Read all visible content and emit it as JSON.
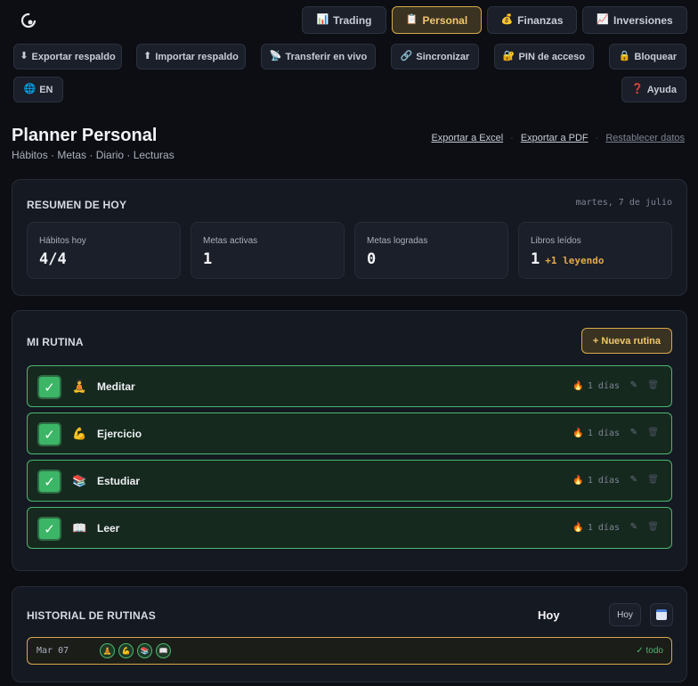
{
  "nav": [
    {
      "label": "Trading",
      "icon": "chart-icon",
      "glyph": "📊",
      "active": false
    },
    {
      "label": "Personal",
      "icon": "clipboard-icon",
      "glyph": "📋",
      "active": true
    },
    {
      "label": "Finanzas",
      "icon": "money-bag-icon",
      "glyph": "💰",
      "active": false
    },
    {
      "label": "Inversiones",
      "icon": "trend-icon",
      "glyph": "📈",
      "active": false
    }
  ],
  "toolbar": {
    "export_backup": "Exportar respaldo",
    "import_backup": "Importar respaldo",
    "transfer_live": "Transferir en vivo",
    "sync": "Sincronizar",
    "pin": "PIN de acceso",
    "lock": "Bloquear",
    "lang": "EN",
    "help": "Ayuda",
    "glyphs": {
      "export": "⬇",
      "import": "⬆",
      "transfer": "📡",
      "sync": "🔗",
      "pin": "🔐",
      "lock": "🔒",
      "lang": "🌐",
      "help": "❓"
    }
  },
  "header": {
    "title": "Planner Personal",
    "subtitle": "Hábitos · Metas · Diario · Lecturas",
    "export_excel": "Exportar a Excel",
    "export_pdf": "Exportar a PDF",
    "reset": "Restablecer datos"
  },
  "summary": {
    "title": "RESUMEN DE HOY",
    "date": "martes, 7 de julio",
    "stats": [
      {
        "label": "Hábitos hoy",
        "value": "4/4",
        "extra": ""
      },
      {
        "label": "Metas activas",
        "value": "1",
        "extra": ""
      },
      {
        "label": "Metas logradas",
        "value": "0",
        "extra": ""
      },
      {
        "label": "Libros leídos",
        "value": "1",
        "extra": "+1 leyendo"
      }
    ]
  },
  "routine": {
    "title": "MI RUTINA",
    "new_button": "+ Nueva rutina",
    "habits": [
      {
        "name": "Meditar",
        "icon": "meditation-icon",
        "glyph": "🧘",
        "streak": "1 días",
        "done": true
      },
      {
        "name": "Ejercicio",
        "icon": "muscle-icon",
        "glyph": "💪",
        "streak": "1 días",
        "done": true
      },
      {
        "name": "Estudiar",
        "icon": "books-icon",
        "glyph": "📚",
        "streak": "1 días",
        "done": true
      },
      {
        "name": "Leer",
        "icon": "open-book-icon",
        "glyph": "📖",
        "streak": "1 días",
        "done": true
      }
    ]
  },
  "history": {
    "title": "HISTORIAL DE RUTINAS",
    "current_label": "Hoy",
    "today_button": "Hoy",
    "rows": [
      {
        "date": "Mar 07",
        "glyphs": [
          "🧘",
          "💪",
          "📚",
          "📖"
        ],
        "status": "✓ todo"
      }
    ]
  },
  "colors": {
    "accent": "#d6a94c",
    "success": "#4ab86e",
    "background": "#0c0e13"
  }
}
